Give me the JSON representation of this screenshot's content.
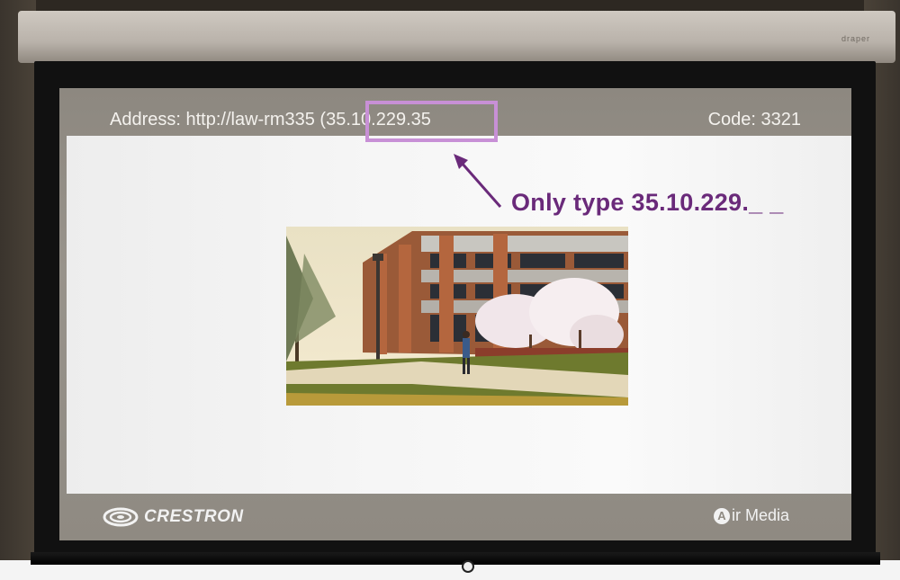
{
  "slide": {
    "address_label": "Address: http://law-rm335 (",
    "address_ip": "35.10.229.35",
    "code_label": "Code: 3321",
    "photo_description_icon": "campus-building-photo",
    "footer_left_logo": "CRESTRON",
    "footer_right_logo_a": "A",
    "footer_right_logo": "ir Media"
  },
  "annotation": {
    "note": "Only type 35.10.229._ _",
    "highlight_color": "#c890d6",
    "text_color": "#6a2a7a"
  },
  "screen": {
    "housing_label": "draper"
  }
}
